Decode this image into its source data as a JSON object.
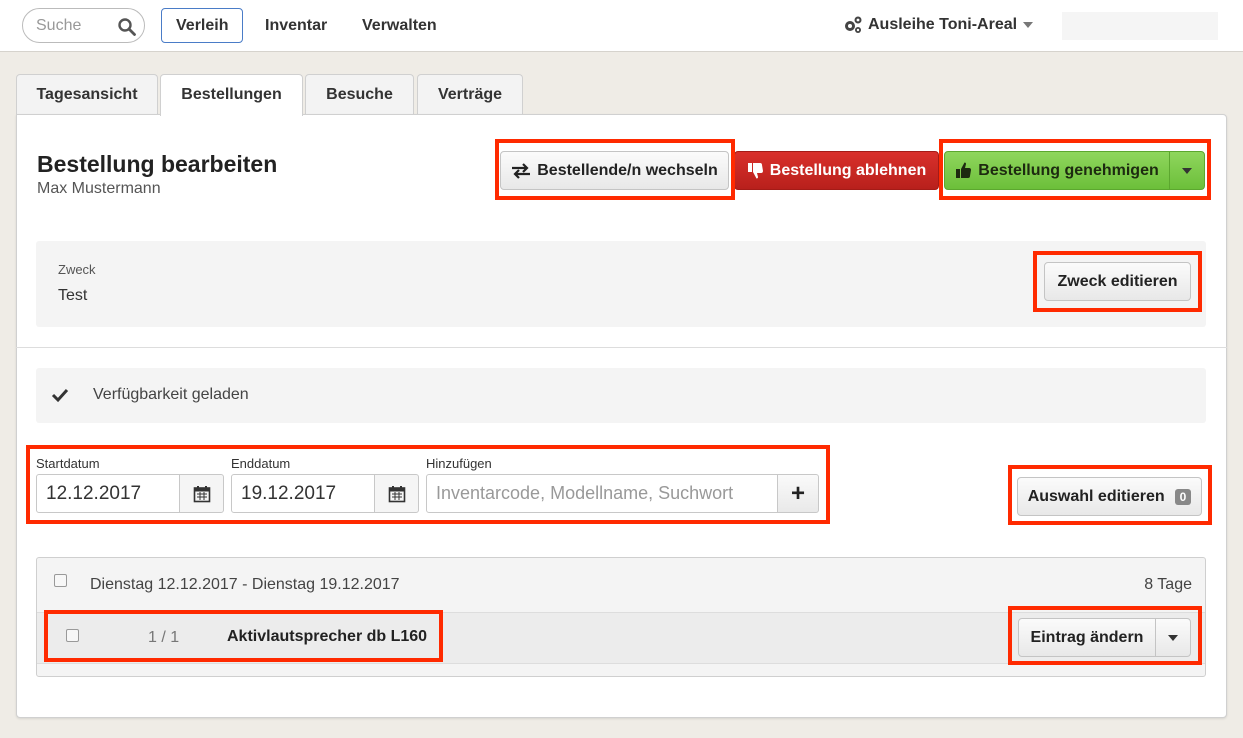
{
  "topbar": {
    "search_placeholder": "Suche",
    "nav": [
      "Verleih",
      "Inventar",
      "Verwalten"
    ],
    "active_nav": "Verleih",
    "context": "Ausleihe Toni-Areal"
  },
  "tabs": [
    "Tagesansicht",
    "Bestellungen",
    "Besuche",
    "Verträge"
  ],
  "active_tab": "Bestellungen",
  "header": {
    "title": "Bestellung bearbeiten",
    "customer": "Max Mustermann",
    "switch_customer_label": "Bestellende/n wechseln",
    "reject_label": "Bestellung ablehnen",
    "approve_label": "Bestellung genehmigen"
  },
  "purpose": {
    "label": "Zweck",
    "value": "Test",
    "edit_label": "Zweck editieren"
  },
  "availability": {
    "status": "Verfügbarkeit geladen"
  },
  "form": {
    "start_label": "Startdatum",
    "start_value": "12.12.2017",
    "end_label": "Enddatum",
    "end_value": "19.12.2017",
    "add_label": "Hinzufügen",
    "add_placeholder": "Inventarcode, Modellname, Suchwort",
    "edit_selection_label": "Auswahl editieren",
    "selection_count": "0"
  },
  "reservations": {
    "period": "Dienstag 12.12.2017 - Dienstag 19.12.2017",
    "duration": "8 Tage",
    "items": [
      {
        "quantity": "1 / 1",
        "name": "Aktivlautsprecher db L160",
        "action_label": "Eintrag ändern"
      }
    ]
  },
  "colors": {
    "highlight": "#ff2a00",
    "reject": "#c9251f",
    "approve": "#7dca4b",
    "active_nav_border": "#4a7cc7"
  }
}
